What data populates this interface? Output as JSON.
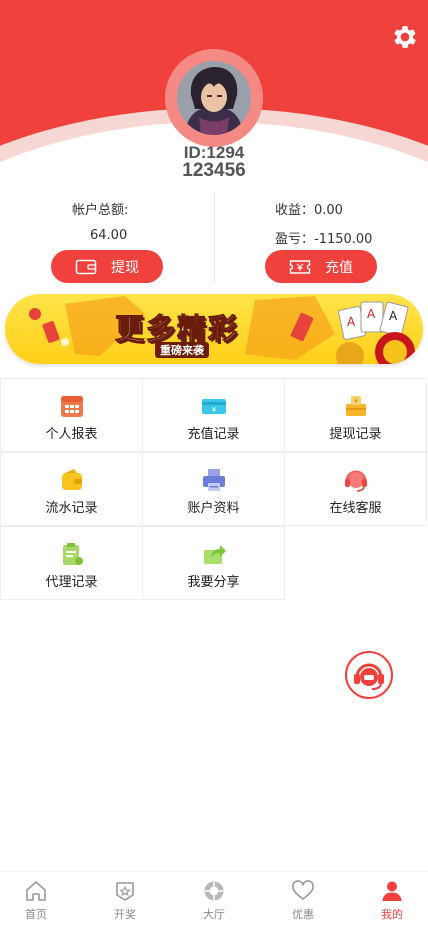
{
  "profile": {
    "id_text": "ID:1294",
    "username": "123456"
  },
  "account": {
    "balance_label": "帐户总额:",
    "balance_value": "64.00",
    "income_text": "收益：0.00",
    "profit_loss_text": "盈亏：-1150.00",
    "withdraw_label": "提现",
    "recharge_label": "充值"
  },
  "banner": {
    "title": "更多精彩",
    "subtitle": "重磅来袭"
  },
  "menu": [
    {
      "label": "个人报表",
      "icon": "calendar-icon"
    },
    {
      "label": "充值记录",
      "icon": "money-card-icon"
    },
    {
      "label": "提现记录",
      "icon": "withdraw-card-icon"
    },
    {
      "label": "流水记录",
      "icon": "wallet-icon"
    },
    {
      "label": "账户资料",
      "icon": "printer-icon"
    },
    {
      "label": "在线客服",
      "icon": "headset-icon"
    },
    {
      "label": "代理记录",
      "icon": "clipboard-icon"
    },
    {
      "label": "我要分享",
      "icon": "share-icon"
    }
  ],
  "tabs": [
    {
      "label": "首页",
      "icon": "home-icon"
    },
    {
      "label": "开奖",
      "icon": "badge-icon"
    },
    {
      "label": "大厅",
      "icon": "ball-icon"
    },
    {
      "label": "优惠",
      "icon": "heart-icon"
    },
    {
      "label": "我的",
      "icon": "user-icon"
    }
  ],
  "colors": {
    "brand_red": "#f0413c",
    "active_tab": "#f0413c",
    "inactive_tab": "#888888"
  }
}
